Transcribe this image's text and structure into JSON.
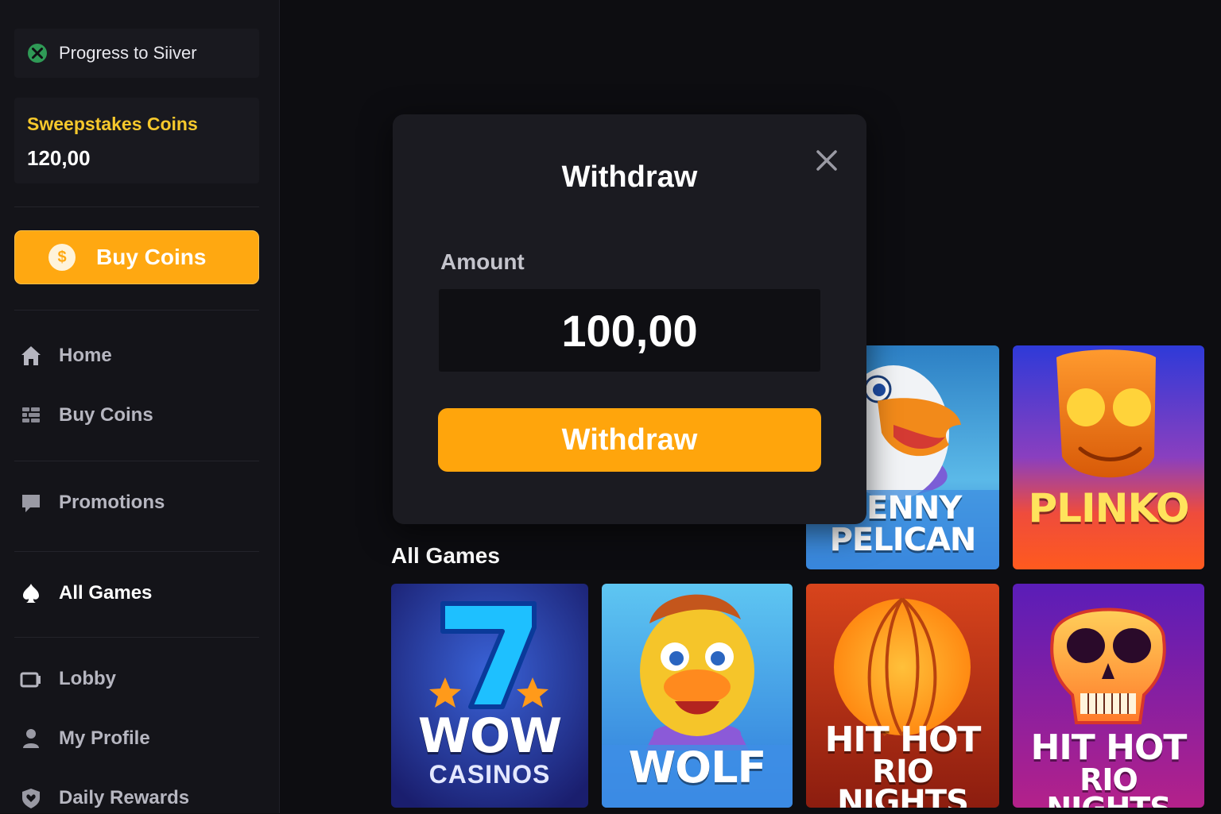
{
  "sidebar": {
    "progress_label": "Progress to Siiver",
    "coins_title": "Sweepstakes Coins",
    "coins_value": "120,00",
    "buy_button": {
      "icon": "dollar-coin-icon",
      "label": "Buy Coins"
    },
    "nav": [
      {
        "label": "Home",
        "icon": "home-icon",
        "active": false
      },
      {
        "label": "Buy Coins",
        "icon": "grid-icon",
        "active": false
      },
      {
        "label": "Promotions",
        "icon": "chat-bubble-icon",
        "active": false
      },
      {
        "label": "All Games",
        "icon": "spade-icon",
        "active": true
      },
      {
        "label": "Lobby",
        "icon": "lobby-icon",
        "active": false
      },
      {
        "label": "My Profile",
        "icon": "user-icon",
        "active": false
      },
      {
        "label": "Daily Rewards",
        "icon": "heart-shield-icon",
        "active": false
      }
    ]
  },
  "main": {
    "section_title": "All Games",
    "top_row": [
      {
        "title_line1": "PENNY",
        "title_line2": "PELICAN"
      },
      {
        "title_line1": "PLINKO"
      }
    ],
    "games": [
      {
        "title": "WOW",
        "subtitle": "CASINOS"
      },
      {
        "title": "WOLF"
      },
      {
        "title_line1": "HIT HOT",
        "title_line2": "RIO NIGHTS"
      },
      {
        "title_line1": "HIT HOT",
        "title_line2": "RIO NIGHTS"
      }
    ]
  },
  "modal": {
    "title": "Withdraw",
    "amount_label": "Amount",
    "amount_value": "100,00",
    "submit_label": "Withdraw"
  },
  "colors": {
    "accent": "#ffa811",
    "coins_title": "#f6c82c",
    "background": "#0d0d11",
    "sidebar": "#141419",
    "modal": "#1b1b21"
  }
}
